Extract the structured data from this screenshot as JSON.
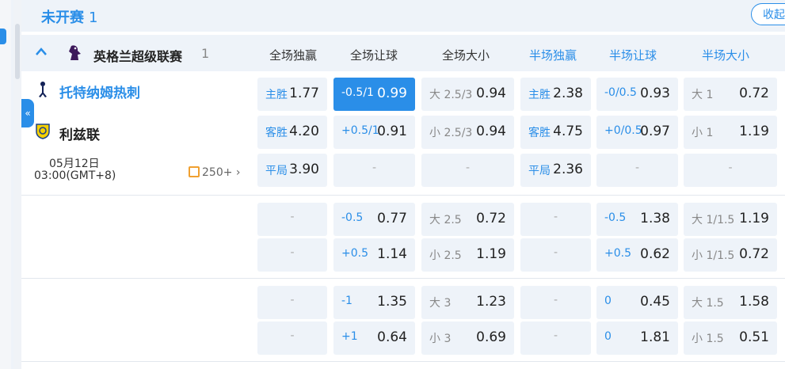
{
  "section": {
    "title": "未开赛",
    "count": "1",
    "collapse_label": "收起"
  },
  "side_tab_glyph": "«",
  "league": {
    "name": "英格兰超级联赛",
    "count": "1",
    "chevron": "^"
  },
  "columns": [
    "全场独赢",
    "全场让球",
    "全场大小",
    "半场独赢",
    "半场让球",
    "半场大小"
  ],
  "match": {
    "home": "托特纳姆热刺",
    "away": "利兹联",
    "date": "05月12日",
    "time": "03:00(GMT+8)",
    "more": "250+"
  },
  "rows": [
    [
      {
        "l": "主胜",
        "v": "1.77"
      },
      {
        "l": "-0.5/1",
        "v": "0.99",
        "hl": true
      },
      {
        "l": "大 2.5/3",
        "v": "0.94",
        "lt": true
      },
      {
        "l": "主胜",
        "v": "2.38"
      },
      {
        "l": "-0/0.5",
        "v": "0.93"
      },
      {
        "l": "大 1",
        "v": "0.72",
        "lt": true
      }
    ],
    [
      {
        "l": "客胜",
        "v": "4.20"
      },
      {
        "l": "+0.5/1",
        "v": "0.91"
      },
      {
        "l": "小 2.5/3",
        "v": "0.94",
        "lt": true
      },
      {
        "l": "客胜",
        "v": "4.75"
      },
      {
        "l": "+0/0.5",
        "v": "0.97"
      },
      {
        "l": "小 1",
        "v": "1.19",
        "lt": true
      }
    ],
    [
      {
        "l": "平局",
        "v": "3.90"
      },
      {
        "d": "-"
      },
      {
        "d": "-"
      },
      {
        "l": "平局",
        "v": "2.36"
      },
      {
        "d": "-"
      },
      {
        "d": "-"
      }
    ],
    [
      {
        "d": "-"
      },
      {
        "l": "-0.5",
        "v": "0.77"
      },
      {
        "l": "大 2.5",
        "v": "0.72",
        "lt": true
      },
      {
        "d": "-"
      },
      {
        "l": "-0.5",
        "v": "1.38"
      },
      {
        "l": "大 1/1.5",
        "v": "1.19",
        "lt": true
      }
    ],
    [
      {
        "d": "-"
      },
      {
        "l": "+0.5",
        "v": "1.14"
      },
      {
        "l": "小 2.5",
        "v": "1.19",
        "lt": true
      },
      {
        "d": "-"
      },
      {
        "l": "+0.5",
        "v": "0.62"
      },
      {
        "l": "小 1/1.5",
        "v": "0.72",
        "lt": true
      }
    ],
    [
      {
        "d": "-"
      },
      {
        "l": "-1",
        "v": "1.35"
      },
      {
        "l": "大 3",
        "v": "1.23",
        "lt": true
      },
      {
        "d": "-"
      },
      {
        "l": "0",
        "v": "0.45"
      },
      {
        "l": "大 1.5",
        "v": "1.58",
        "lt": true
      }
    ],
    [
      {
        "d": "-"
      },
      {
        "l": "+1",
        "v": "0.64"
      },
      {
        "l": "小 3",
        "v": "0.69",
        "lt": true
      },
      {
        "d": "-"
      },
      {
        "l": "0",
        "v": "1.81"
      },
      {
        "l": "小 1.5",
        "v": "0.51",
        "lt": true
      }
    ]
  ]
}
